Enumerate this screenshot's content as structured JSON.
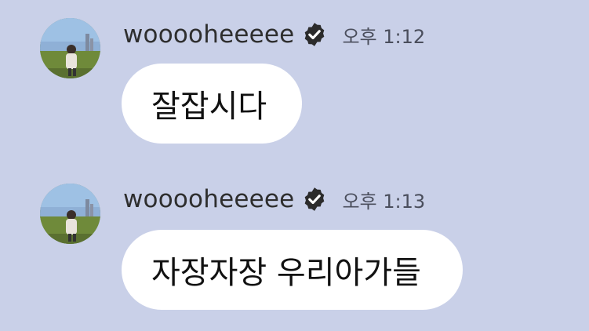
{
  "theme": {
    "background": "#c9d0e8",
    "bubble_background": "#ffffff",
    "verified_badge_color": "#2b2b2b"
  },
  "messages": [
    {
      "username": "wooooheeeee",
      "verified_icon": "verified-badge-icon",
      "timestamp": "오후 1:12",
      "text": "잘잡시다"
    },
    {
      "username": "wooooheeeee",
      "verified_icon": "verified-badge-icon",
      "timestamp": "오후 1:13",
      "text": "자장자장 우리아가들"
    }
  ]
}
